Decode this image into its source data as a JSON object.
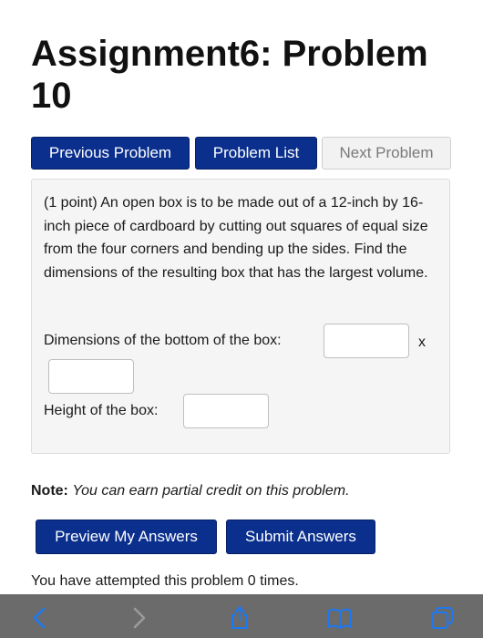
{
  "page": {
    "title": "Assignment6: Problem 10"
  },
  "nav": {
    "previous_label": "Previous Problem",
    "list_label": "Problem List",
    "next_label": "Next Problem"
  },
  "problem": {
    "text": "(1 point) An open box is to be made out of a 12-inch by 16-inch piece of cardboard by cutting out squares of equal size from the four corners and bending up the sides. Find the dimensions of the resulting box that has the largest volume.",
    "bottom_label": "Dimensions of the bottom of the box:",
    "times_symbol": "x",
    "height_label": "Height of the box:",
    "answer_1_value": "",
    "answer_2_value": "",
    "answer_3_value": ""
  },
  "note": {
    "prefix": "Note:",
    "text": "You can earn partial credit on this problem."
  },
  "actions": {
    "preview_label": "Preview My Answers",
    "submit_label": "Submit Answers"
  },
  "status": {
    "attempts_text": "You have attempted this problem 0 times."
  },
  "toolbar": {
    "back_icon": "chevron-left-icon",
    "forward_icon": "chevron-right-icon",
    "share_icon": "share-icon",
    "bookmarks_icon": "book-icon",
    "tabs_icon": "tabs-icon",
    "icon_color": "#1b78f2",
    "disabled_icon_color": "#9a9a9a"
  }
}
